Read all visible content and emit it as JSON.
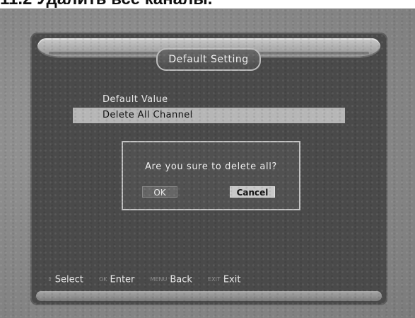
{
  "caption": "11.2 Удалить все каналы.",
  "title": "Default Setting",
  "menu": {
    "items": [
      {
        "label": "Default Value"
      },
      {
        "label": "Delete All Channel"
      }
    ]
  },
  "dialog": {
    "message": "Are you sure to delete all?",
    "ok_label": "OK",
    "cancel_label": "Cancel"
  },
  "footer": {
    "items": [
      {
        "key": "⇕",
        "label": "Select"
      },
      {
        "key": "OK",
        "label": "Enter"
      },
      {
        "key": "MENU",
        "label": "Back"
      },
      {
        "key": "EXIT",
        "label": "Exit"
      }
    ]
  }
}
